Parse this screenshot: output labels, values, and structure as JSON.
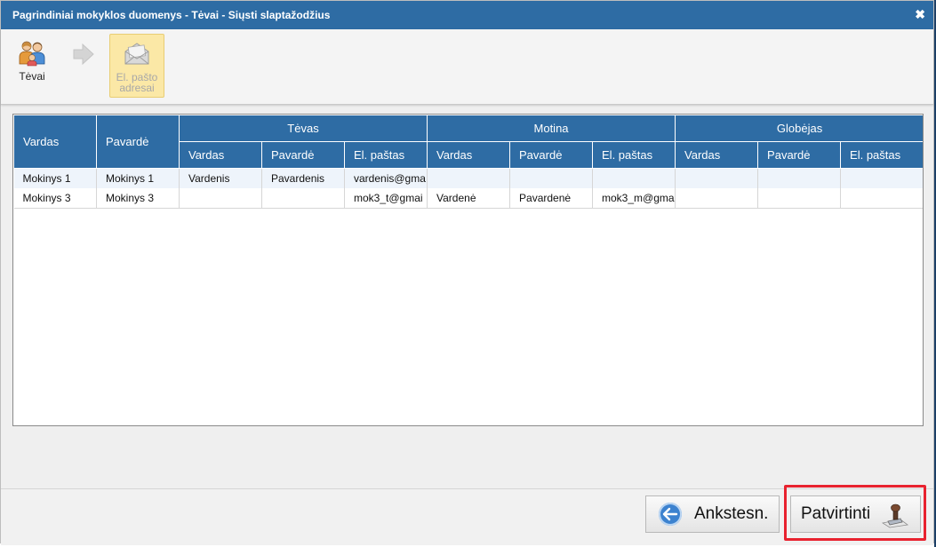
{
  "window": {
    "title": "Pagrindiniai mokyklos duomenys - Tėvai - Siųsti slaptažodžius",
    "close_glyph": "✖"
  },
  "toolbar": {
    "items": [
      {
        "label": "Tėvai",
        "icon": "parents-icon",
        "active": true
      },
      {
        "label": "El. pašto adresai",
        "icon": "envelope-icon",
        "active": false
      }
    ]
  },
  "grid": {
    "headers": {
      "vardas": "Vardas",
      "pavarde": "Pavardė",
      "groups": [
        "Tėvas",
        "Motina",
        "Globėjas"
      ],
      "sub": [
        "Vardas",
        "Pavardė",
        "El. paštas"
      ]
    },
    "rows": [
      [
        "Mokinys 1",
        "Mokinys 1",
        "Vardenis",
        "Pavardenis",
        "vardenis@gma",
        "",
        "",
        "",
        "",
        "",
        ""
      ],
      [
        "Mokinys 3",
        "Mokinys 3",
        "",
        "",
        "mok3_t@gmai",
        "Vardenė",
        "Pavardenė",
        "mok3_m@gma",
        "",
        "",
        ""
      ]
    ]
  },
  "footer": {
    "back_label": "Ankstesn.",
    "confirm_label": "Patvirtinti"
  },
  "colors": {
    "header_blue": "#2e6ca4",
    "highlight_red": "#e8222f",
    "selected_toolbar": "#fbe8a6"
  }
}
